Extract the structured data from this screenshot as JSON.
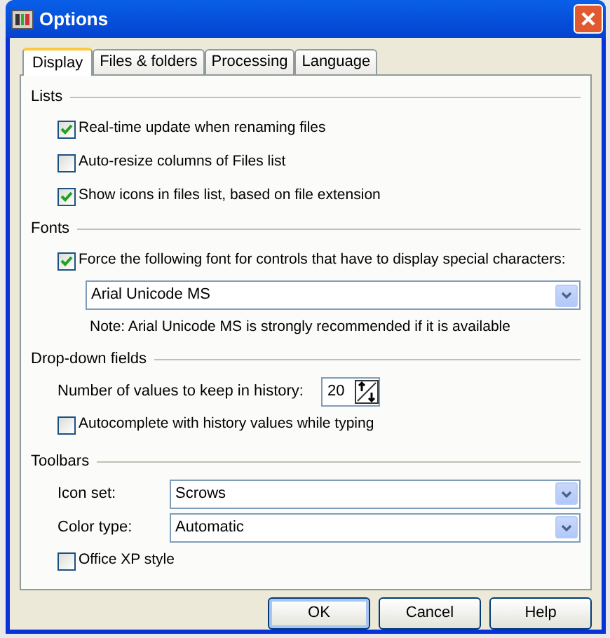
{
  "window": {
    "title": "Options"
  },
  "tabs": [
    {
      "label": "Display",
      "selected": true
    },
    {
      "label": "Files & folders",
      "selected": false
    },
    {
      "label": "Processing",
      "selected": false
    },
    {
      "label": "Language",
      "selected": false
    }
  ],
  "sections": [
    {
      "title": "Lists",
      "items": [
        {
          "kind": "checkbox",
          "label": "Real-time update when renaming files",
          "checked": true
        },
        {
          "kind": "checkbox",
          "label": "Auto-resize columns of Files list",
          "checked": false
        },
        {
          "kind": "checkbox",
          "label": "Show icons in files list, based on file extension",
          "checked": true
        }
      ]
    },
    {
      "title": "Fonts",
      "items": [
        {
          "kind": "checkbox",
          "label": "Force the following font for controls that have to display special characters:",
          "checked": true
        },
        {
          "kind": "select",
          "value": "Arial Unicode MS"
        },
        {
          "kind": "note",
          "text": "Note: Arial Unicode MS is strongly recommended if it is available"
        }
      ]
    },
    {
      "title": "Drop-down fields",
      "items": [
        {
          "kind": "spinner",
          "label": "Number of values to keep in history:",
          "value": "20"
        },
        {
          "kind": "checkbox",
          "label": "Autocomplete with history values while typing",
          "checked": false
        }
      ]
    },
    {
      "title": "Toolbars",
      "items": [
        {
          "kind": "labeled_select",
          "label": "Icon set:",
          "value": "Scrows"
        },
        {
          "kind": "labeled_select",
          "label": "Color type:",
          "value": "Automatic"
        },
        {
          "kind": "checkbox",
          "label": "Office XP style",
          "checked": false
        }
      ]
    }
  ],
  "buttons": [
    {
      "label": "OK",
      "default": true
    },
    {
      "label": "Cancel",
      "default": false
    },
    {
      "label": "Help",
      "default": false
    }
  ]
}
